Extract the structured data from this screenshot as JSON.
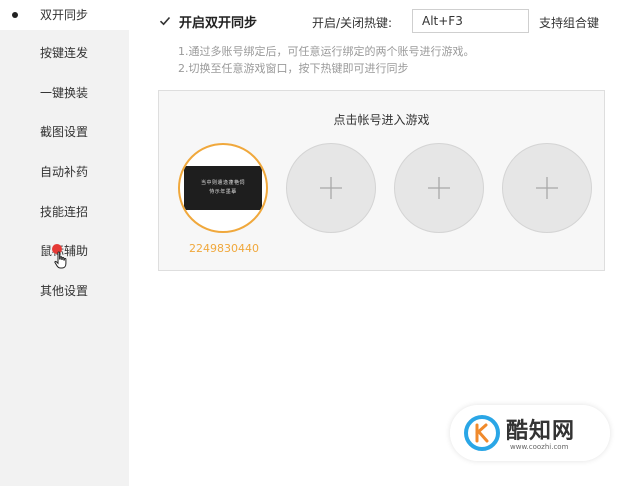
{
  "sidebar": {
    "items": [
      {
        "label": "双开同步",
        "active": true
      },
      {
        "label": "按键连发"
      },
      {
        "label": "一键换装"
      },
      {
        "label": "截图设置"
      },
      {
        "label": "自动补药"
      },
      {
        "label": "技能连招"
      },
      {
        "label": "鼠标辅助"
      },
      {
        "label": "其他设置"
      }
    ]
  },
  "sync": {
    "enabled": true,
    "enable_label": "开启双开同步",
    "hotkey_label": "开启/关闭热键:",
    "hotkey_value": "Alt+F3",
    "combo_label": "支持组合键",
    "hints": [
      "1.通过多账号绑定后，可任意运行绑定的两个账号进行游戏。",
      "2.切换至任意游戏窗口，按下热键即可进行同步"
    ]
  },
  "accounts": {
    "title": "点击帐号进入游戏",
    "bound_account": {
      "id": "2249830440",
      "thumb_lines": [
        "当中则遣逸蓬艳饲",
        "恃示年墨摹"
      ]
    },
    "empty_slot_icon": "plus-icon"
  },
  "watermark": {
    "name": "酷知网",
    "url": "www.coozhi.com"
  },
  "colors": {
    "sidebar_bg": "#f2f2f2",
    "accent_orange": "#f0a83c",
    "badge_red": "#e53935"
  }
}
